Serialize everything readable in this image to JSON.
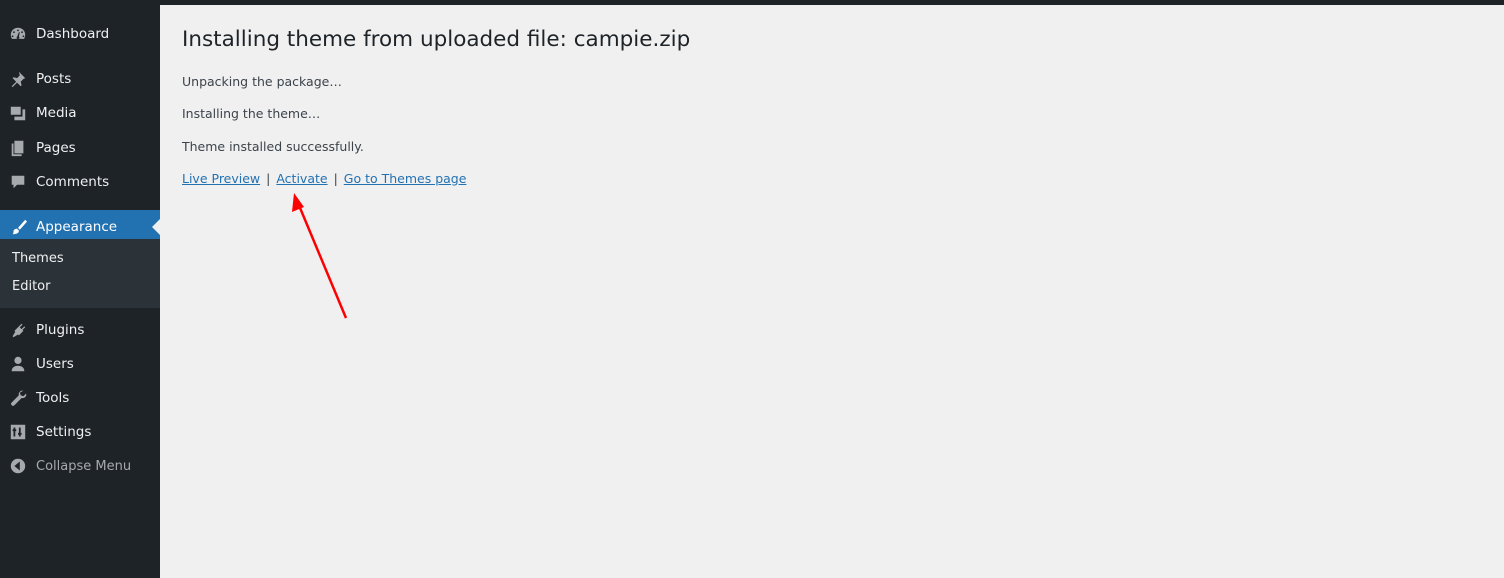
{
  "sidebar": {
    "items": [
      {
        "label": "Dashboard",
        "icon": "dashboard-icon"
      },
      {
        "label": "Posts",
        "icon": "pushpin-icon"
      },
      {
        "label": "Media",
        "icon": "media-icon"
      },
      {
        "label": "Pages",
        "icon": "pages-icon"
      },
      {
        "label": "Comments",
        "icon": "comment-icon"
      },
      {
        "label": "Appearance",
        "icon": "paintbrush-icon"
      },
      {
        "label": "Plugins",
        "icon": "plug-icon"
      },
      {
        "label": "Users",
        "icon": "user-icon"
      },
      {
        "label": "Tools",
        "icon": "wrench-icon"
      },
      {
        "label": "Settings",
        "icon": "settings-sliders-icon"
      },
      {
        "label": "Collapse Menu",
        "icon": "collapse-arrow-icon"
      }
    ],
    "submenu": [
      {
        "label": "Themes"
      },
      {
        "label": "Editor"
      }
    ],
    "current": "Appearance"
  },
  "main": {
    "title": "Installing theme from uploaded file: campie.zip",
    "messages": [
      "Unpacking the package…",
      "Installing the theme…",
      "Theme installed successfully."
    ],
    "actions": {
      "live_preview": "Live Preview",
      "separator": "|",
      "activate": "Activate",
      "go_to_themes": "Go to Themes page"
    }
  },
  "colors": {
    "sidebar_bg": "#1d2327",
    "accent": "#2271b1",
    "annotation_arrow": "#ff0000"
  }
}
